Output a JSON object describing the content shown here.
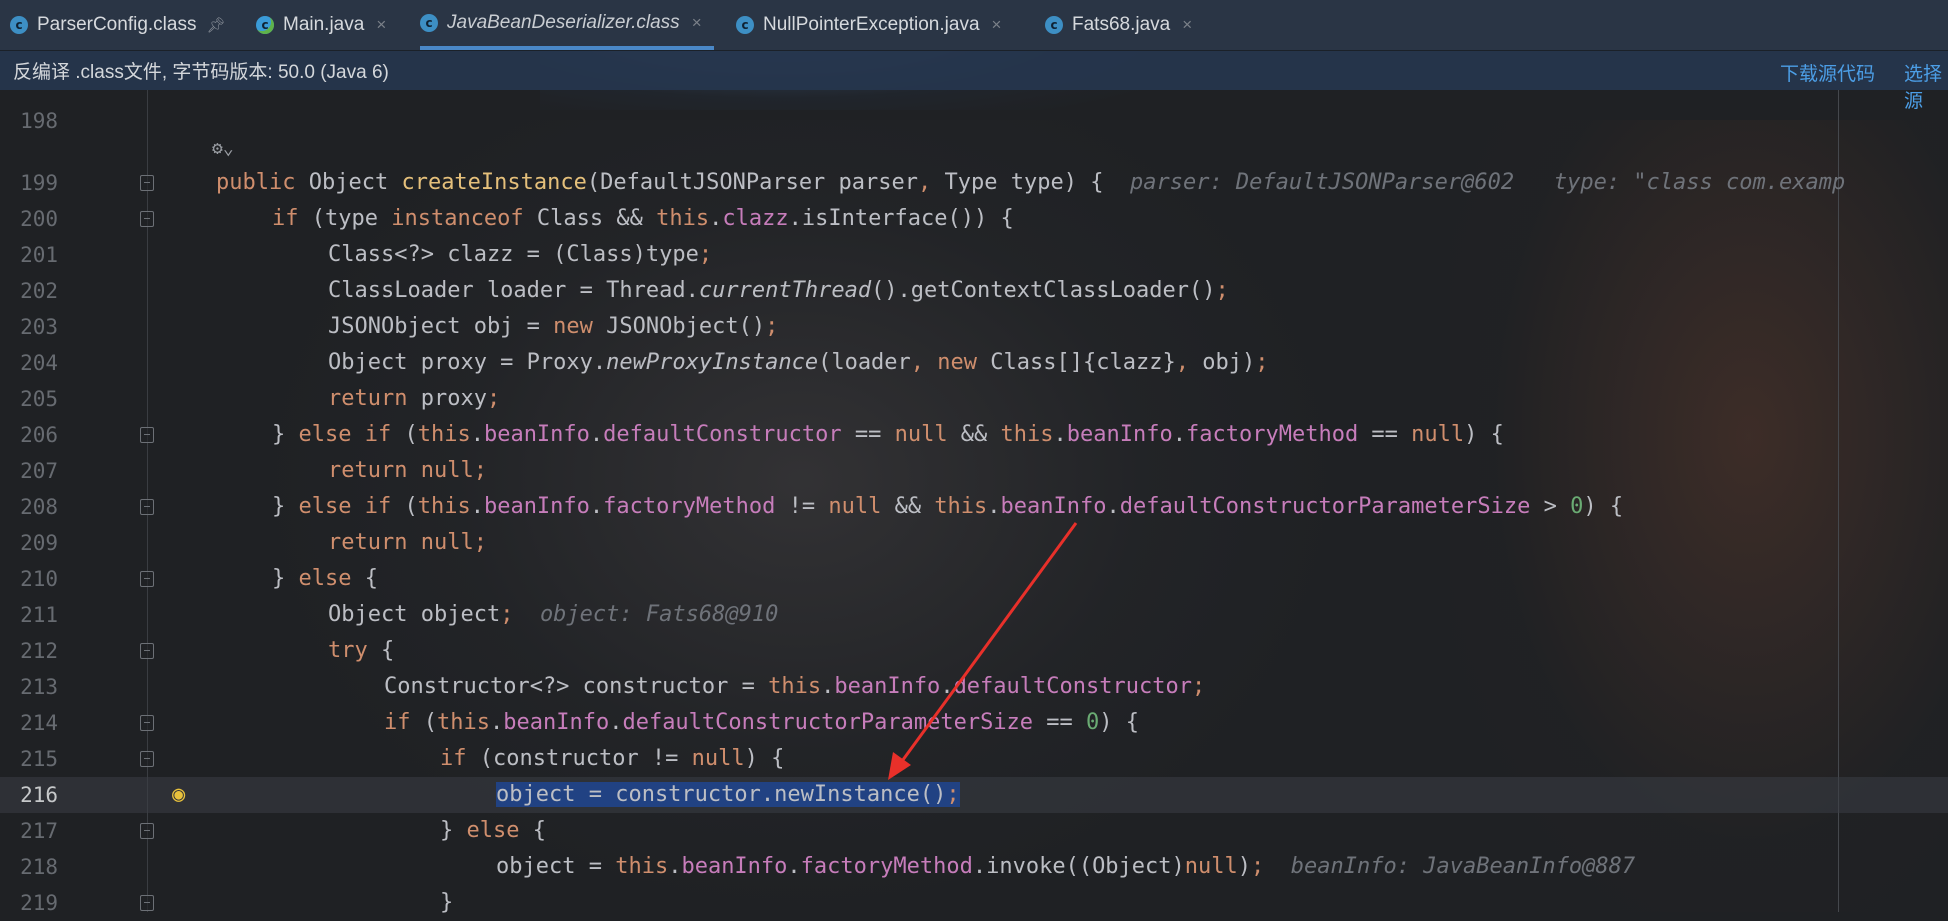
{
  "tabs": [
    {
      "label": "ParserConfig.class",
      "icon": "class-icon",
      "pinned": true
    },
    {
      "label": "Main.java",
      "icon": "java-modified-icon",
      "close": "×"
    },
    {
      "label": "JavaBeanDeserializer.class",
      "icon": "class-icon",
      "active": true,
      "close": "×"
    },
    {
      "label": "NullPointerException.java",
      "icon": "class-icon",
      "close": "×"
    },
    {
      "label": "Fats68.java",
      "icon": "class-icon",
      "close": "×"
    }
  ],
  "banner": {
    "text": "反编译 .class文件, 字节码版本: 50.0 (Java 6)",
    "download_link": "下载源代码",
    "choose_link": "选择源"
  },
  "annotation": "⚙⌄",
  "lines": [
    {
      "num": "198"
    },
    {
      "num": "199",
      "hint1": "parser: DefaultJSONParser@602",
      "hint2": "type: \"class com.examp"
    },
    {
      "num": "200"
    },
    {
      "num": "201"
    },
    {
      "num": "202"
    },
    {
      "num": "203"
    },
    {
      "num": "204"
    },
    {
      "num": "205"
    },
    {
      "num": "206"
    },
    {
      "num": "207"
    },
    {
      "num": "208"
    },
    {
      "num": "209"
    },
    {
      "num": "210"
    },
    {
      "num": "211",
      "hint1": "object: Fats68@910"
    },
    {
      "num": "212"
    },
    {
      "num": "213"
    },
    {
      "num": "214"
    },
    {
      "num": "215"
    },
    {
      "num": "216",
      "current": true
    },
    {
      "num": "217"
    },
    {
      "num": "218",
      "hint1": "beanInfo: JavaBeanInfo@887"
    },
    {
      "num": "219"
    }
  ],
  "colors": {
    "keyword": "#cf8e6d",
    "field": "#c77dbb",
    "method": "#e5c07b",
    "number": "#6aab73",
    "selection": "#214283",
    "arrow": "#e8302a",
    "accent": "#4a88c7"
  }
}
